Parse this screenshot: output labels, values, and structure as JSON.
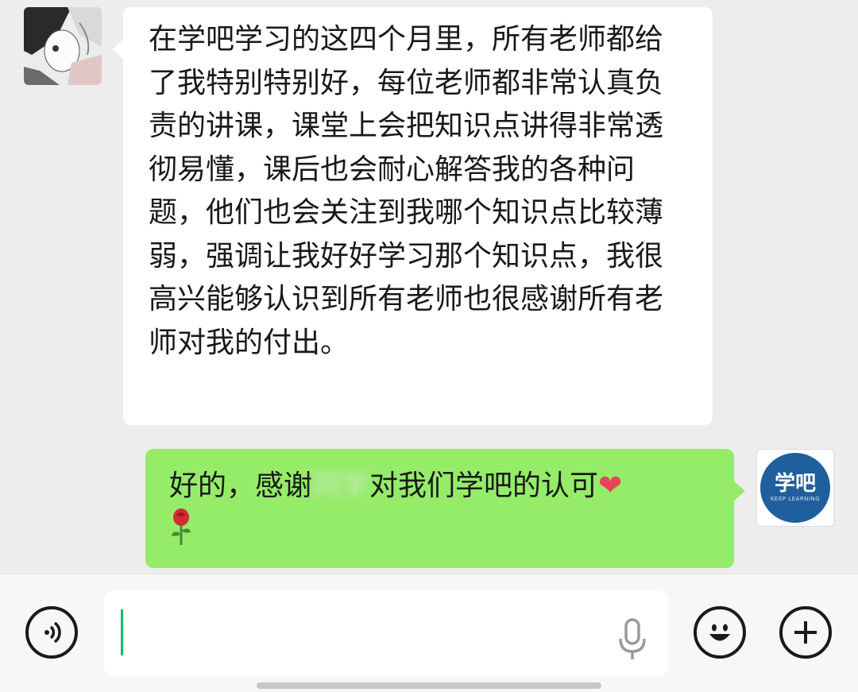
{
  "messages": {
    "incoming": {
      "text": "在学吧学习的这四个月里，所有老师都给了我特别特别好，每位老师都非常认真负责的讲课，课堂上会把知识点讲得非常透彻易懂，课后也会耐心解答我的各种问题，他们也会关注到我哪个知识点比较薄弱，强调让我好好学习那个知识点，我很高兴能够认识到所有老师也很感谢所有老师对我的付出。",
      "avatar": "anime-avatar"
    },
    "outgoing": {
      "text_before": "好的，感谢",
      "blurred": "同学",
      "text_after": "对我们学吧的认可",
      "emoji_heart": "❤",
      "emoji_rose": "🌹",
      "avatar_logo_text": "学吧",
      "avatar_logo_subtext": "KEEP LEARNING"
    }
  },
  "input_bar": {
    "value": "",
    "voice_icon": "voice-icon",
    "mic_icon": "microphone-icon",
    "emoji_icon": "emoji-icon",
    "plus_icon": "plus-icon"
  },
  "colors": {
    "background": "#ededed",
    "incoming_bubble": "#ffffff",
    "outgoing_bubble": "#95ec69",
    "caret": "#07c160"
  }
}
